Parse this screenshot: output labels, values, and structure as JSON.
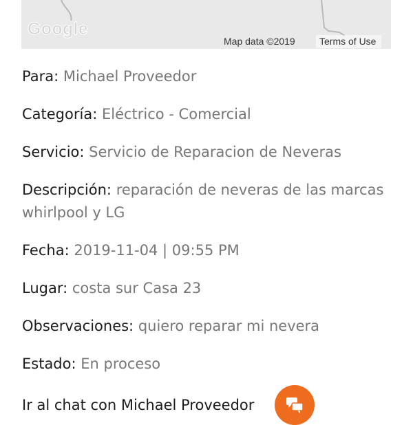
{
  "map": {
    "logo_text": "Google",
    "data_text": "Map data ©2019",
    "terms_text": "Terms of Use"
  },
  "details": {
    "para": {
      "label": "Para:",
      "value": "Michael Proveedor"
    },
    "categoria": {
      "label": "Categoría:",
      "value": "Eléctrico - Comercial"
    },
    "servicio": {
      "label": "Servicio:",
      "value": "Servicio de Reparacion de Neveras"
    },
    "descripcion": {
      "label": "Descripción:",
      "value": "reparación de neveras de las marcas whirlpool y LG"
    },
    "fecha": {
      "label": "Fecha:",
      "value": "2019-11-04 | 09:55 PM"
    },
    "lugar": {
      "label": "Lugar:",
      "value": "costa sur Casa 23"
    },
    "observaciones": {
      "label": "Observaciones:",
      "value": "quiero reparar mi nevera"
    },
    "estado": {
      "label": "Estado:",
      "value": "En proceso"
    }
  },
  "chat": {
    "label": "Ir al chat con Michael Proveedor",
    "icon": "chat-bubbles-icon",
    "color": "#ee6c1e"
  }
}
